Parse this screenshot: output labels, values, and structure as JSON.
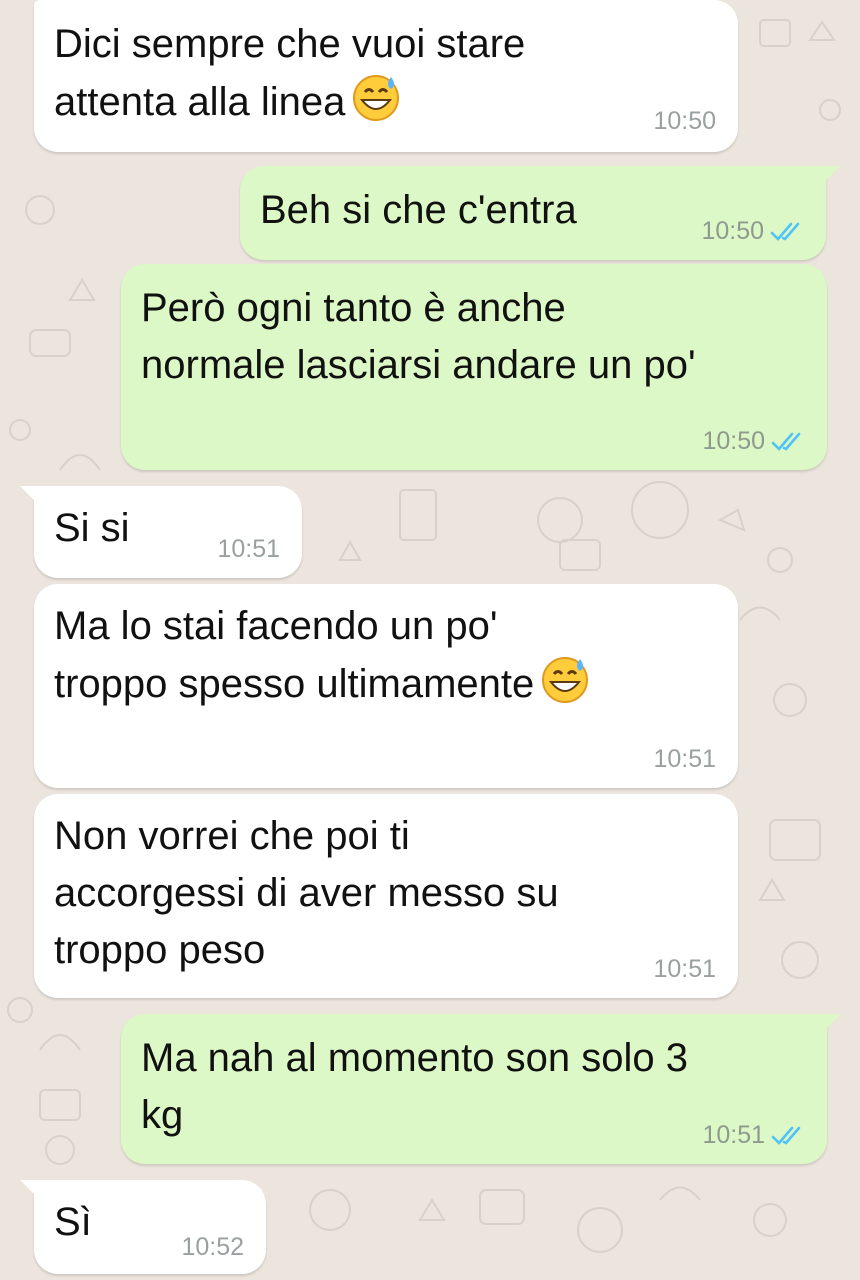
{
  "colors": {
    "background": "#ece5dd",
    "incoming_bubble": "#ffffff",
    "outgoing_bubble": "#dcf8c6",
    "read_ticks": "#4fc3f7",
    "timestamp": "#8f9a8e"
  },
  "messages": [
    {
      "direction": "in",
      "text": "Dici sempre che vuoi stare\nattenta alla linea",
      "emoji": "grinning-face-with-sweat",
      "time": "10:50"
    },
    {
      "direction": "out",
      "text": "Beh si che c'entra",
      "time": "10:50",
      "status": "read"
    },
    {
      "direction": "out",
      "text": "Però ogni tanto è anche\nnormale lasciarsi andare un po'",
      "time": "10:50",
      "status": "read"
    },
    {
      "direction": "in",
      "text": "Si si",
      "time": "10:51"
    },
    {
      "direction": "in",
      "text": "Ma lo stai facendo un po'\ntroppo spesso ultimamente",
      "emoji": "grinning-face-with-sweat",
      "time": "10:51"
    },
    {
      "direction": "in",
      "text": "Non vorrei che poi ti\naccorgessi di aver messo su\ntroppo peso",
      "time": "10:51"
    },
    {
      "direction": "out",
      "text": "Ma nah al momento son solo 3\nkg",
      "time": "10:51",
      "status": "read"
    },
    {
      "direction": "in",
      "text": "Sì",
      "time": "10:52"
    }
  ]
}
